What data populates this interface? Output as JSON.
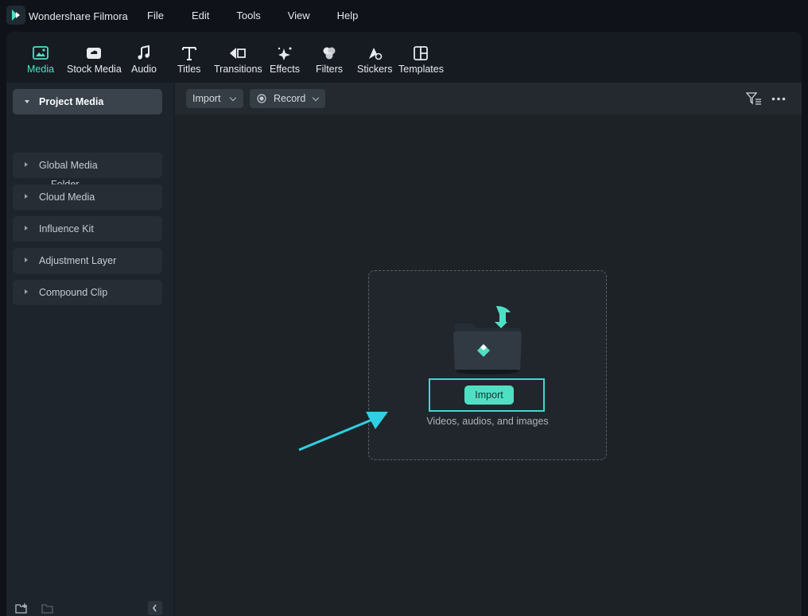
{
  "app": {
    "title": "Wondershare Filmora"
  },
  "menu": [
    "File",
    "Edit",
    "Tools",
    "View",
    "Help"
  ],
  "toolbar": {
    "items": [
      {
        "label": "Media",
        "icon": "media-icon",
        "active": true
      },
      {
        "label": "Stock Media",
        "icon": "stock-media-icon"
      },
      {
        "label": "Audio",
        "icon": "music-note-icon"
      },
      {
        "label": "Titles",
        "icon": "text-t-icon"
      },
      {
        "label": "Transitions",
        "icon": "transitions-icon"
      },
      {
        "label": "Effects",
        "icon": "sparkle-icon"
      },
      {
        "label": "Filters",
        "icon": "filters-icon"
      },
      {
        "label": "Stickers",
        "icon": "stickers-icon"
      },
      {
        "label": "Templates",
        "icon": "templates-icon"
      }
    ],
    "accent_color": "#4fe0c4"
  },
  "sidebar": {
    "items": [
      {
        "label": "Project Media",
        "expanded": true
      },
      {
        "label": "Global Media"
      },
      {
        "label": "Cloud Media"
      },
      {
        "label": "Influence Kit"
      },
      {
        "label": "Adjustment Layer"
      },
      {
        "label": "Compound Clip"
      }
    ],
    "folder": "Folder"
  },
  "subbar": {
    "import_label": "Import",
    "record_label": "Record"
  },
  "dropzone": {
    "button_label": "Import",
    "hint": "Videos, audios, and images"
  }
}
